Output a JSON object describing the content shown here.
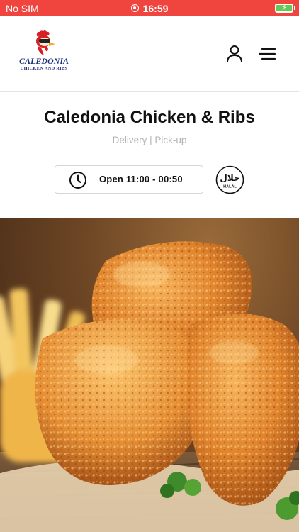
{
  "status_bar": {
    "carrier": "No SIM",
    "time": "16:59",
    "recording_icon": "recording-icon",
    "battery_icon": "battery-charging-icon"
  },
  "header": {
    "logo": {
      "brand": "CALEDONIA",
      "tagline": "CHICKEN AND RIBS"
    },
    "user_icon": "user-icon",
    "menu_icon": "menu-icon"
  },
  "restaurant": {
    "name": "Caledonia Chicken & Ribs",
    "services": "Delivery | Pick-up",
    "hours": "Open 11:00 - 00:50",
    "clock_icon": "clock-icon",
    "badge_text": "HALAL",
    "badge_arabic": "حلال"
  },
  "hero": {
    "image": "fried-chicken-photo"
  },
  "colors": {
    "status_bar": "#f0453f",
    "brand_blue": "#1c2f7a",
    "subtitle_gray": "#b3b3b3"
  }
}
